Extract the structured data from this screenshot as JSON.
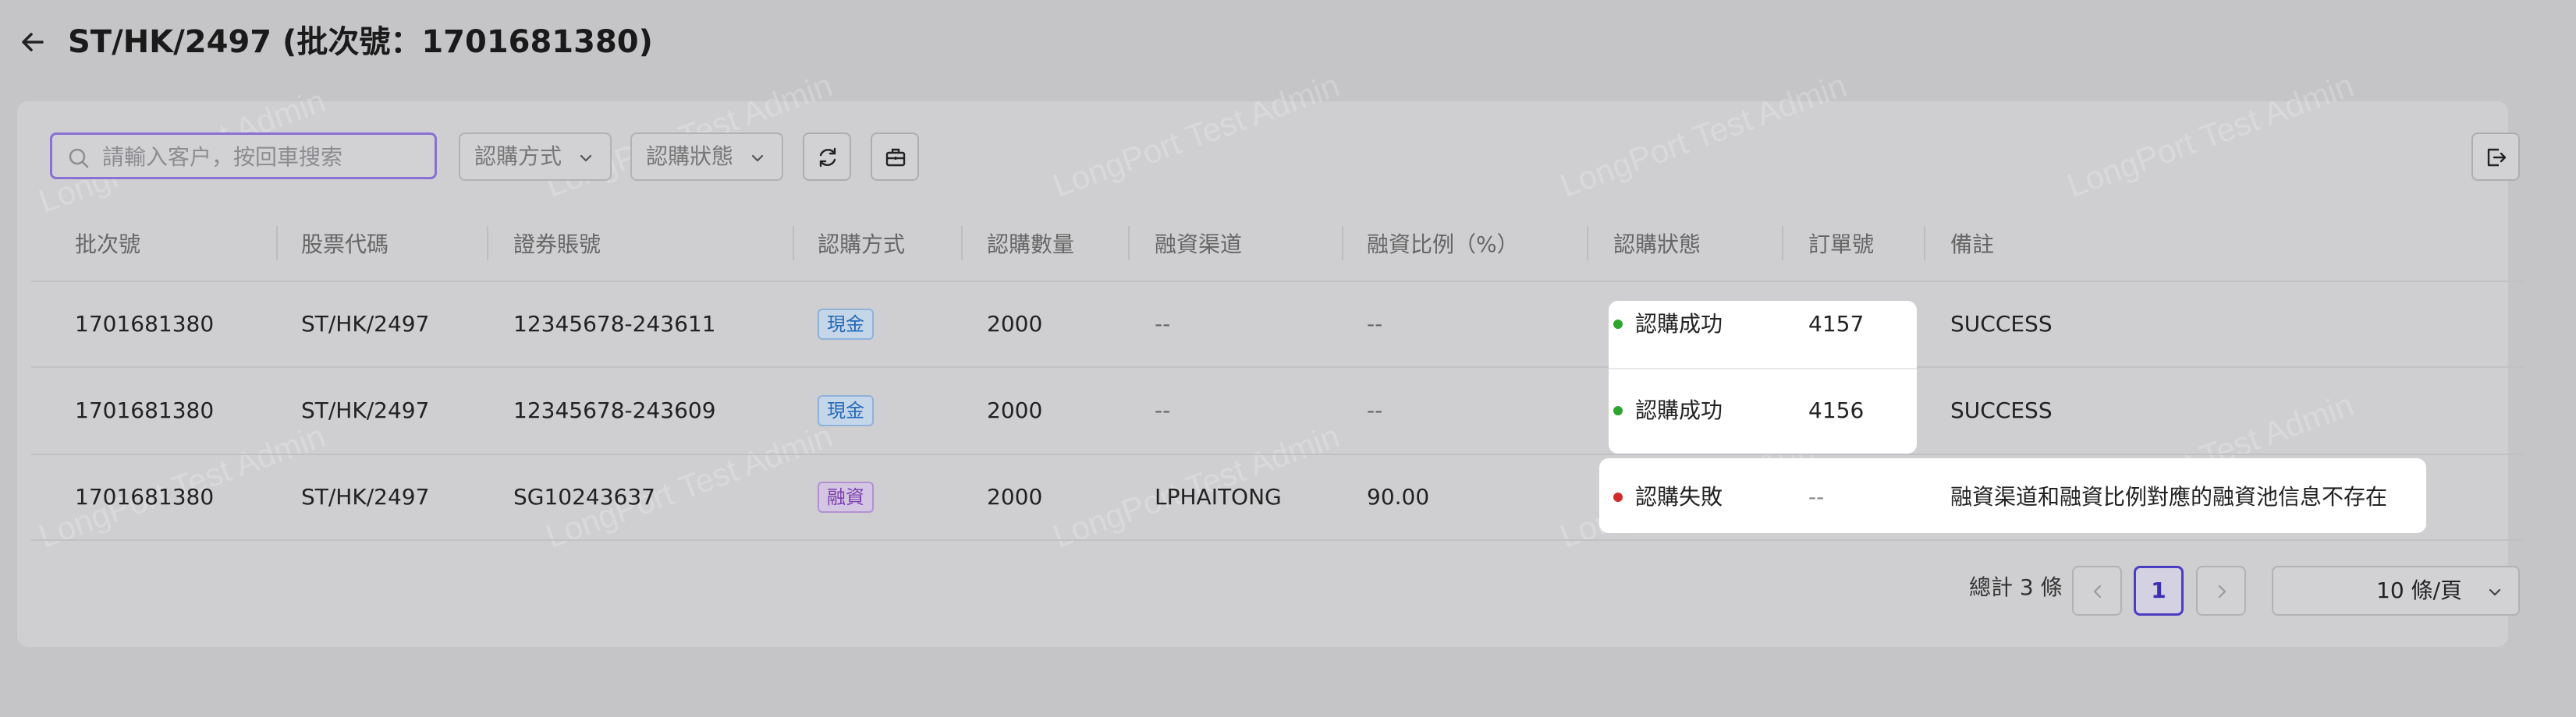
{
  "header": {
    "title": "ST/HK/2497 (批次號：1701681380)",
    "back_icon": "arrow-left-icon"
  },
  "watermark": "LongPort Test Admin",
  "toolbar": {
    "search_placeholder": "請輸入客户，按回車搜索",
    "subscribe_method_select": "認購方式",
    "subscribe_status_select": "認購狀態",
    "refresh_icon": "refresh-icon",
    "column_settings_icon": "briefcase-icon",
    "export_icon": "export-icon"
  },
  "table": {
    "columns": [
      "批次號",
      "股票代碼",
      "證券賬號",
      "認購方式",
      "認購數量",
      "融資渠道",
      "融資比例（%）",
      "認購狀態",
      "訂單號",
      "備註"
    ],
    "rows": [
      {
        "batch": "1701681380",
        "stock": "ST/HK/2497",
        "account": "12345678-243611",
        "method": "現金",
        "qty": "2000",
        "channel": "--",
        "ratio": "--",
        "status": "認購成功",
        "order": "4157",
        "remark": "SUCCESS"
      },
      {
        "batch": "1701681380",
        "stock": "ST/HK/2497",
        "account": "12345678-243609",
        "method": "現金",
        "qty": "2000",
        "channel": "--",
        "ratio": "--",
        "status": "認購成功",
        "order": "4156",
        "remark": "SUCCESS"
      },
      {
        "batch": "1701681380",
        "stock": "ST/HK/2497",
        "account": "SG10243637",
        "method": "融資",
        "qty": "2000",
        "channel": "LPHAITONG",
        "ratio": "90.00",
        "status": "認購失敗",
        "order": "--",
        "remark": "融資渠道和融資比例對應的融資池信息不存在"
      }
    ]
  },
  "colors": {
    "cash_tag": "#2569b8",
    "finance_tag": "#7a3db0",
    "success_dot": "#2fa52f",
    "fail_dot": "#d12a2a",
    "accent": "#4b3dc2"
  },
  "pagination": {
    "total": "總計 3 條",
    "current_page": "1",
    "page_size": "10 條/頁"
  }
}
